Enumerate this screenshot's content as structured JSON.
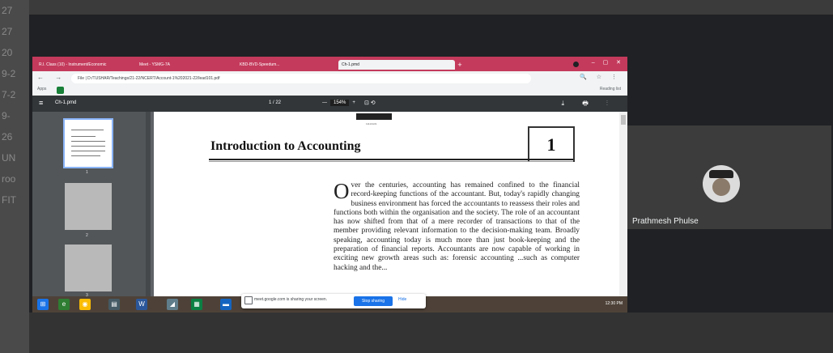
{
  "participant": {
    "name": "Prathmesh Phulse"
  },
  "browser": {
    "tabs": [
      {
        "label": "R.I. Class (10) - Instrument/Economic"
      },
      {
        "label": "Meet - YSMG-7A"
      },
      {
        "label": "KBD-BVD-Speedum..."
      },
      {
        "label": "Ch-1.pmd"
      }
    ],
    "new_tab": "+",
    "window_buttons": "– ▢ ✕",
    "nav_icons": "← → C",
    "url": "File | D:/TUSHAR/Teachings/21-22/NCERT/Account-1%202021-22/lead101.pdf",
    "address_icons": "🔍 ☆ ⋮",
    "bookmarks_apps": "Apps",
    "reading_list": "Reading list"
  },
  "pdf_toolbar": {
    "menu_icon": "≡",
    "file_name": "Ch-1.pmd",
    "page": "1 / 22",
    "zoom_minus": "—",
    "zoom": "154%",
    "zoom_plus": "+",
    "fit_icons": "⊡ ⟲",
    "actions": "⤓ 🖶 ⋮"
  },
  "thumbnails": [
    {
      "num": "1"
    },
    {
      "num": "2"
    },
    {
      "num": "3"
    }
  ],
  "document": {
    "qr_caption": "1111CH01",
    "title": "Introduction to Accounting",
    "chapter_number": "1",
    "drop_cap": "O",
    "body": "ver the centuries, accounting has remained confined to the financial record-keeping functions of the accountant. But, today's rapidly changing business environment has forced the accountants to reassess their roles and functions both within the organisation and the society. The role of an accountant has now shifted from that of a mere recorder of transactions to that of the member providing relevant information to the decision-making team. Broadly speaking, accounting today is much more than just book-keeping and the preparation of financial reports. Accountants are now capable of working in exciting new growth areas such as: forensic accounting ...such as computer hacking and the..."
  },
  "share_bar": {
    "message": "meet.google.com is sharing your screen.",
    "stop_label": "Stop sharing",
    "hide_label": "Hide"
  },
  "taskbar": {
    "icons": [
      "⊞",
      "e",
      "◉",
      "▤",
      "W",
      "◢",
      "▦",
      "▬"
    ],
    "icon_colors": [
      "#1a73e8",
      "#2e7d32",
      "#fbbc04",
      "#455a64",
      "#2b579a",
      "#607d8b",
      "#0b8043",
      "#1565c0"
    ],
    "tray": "12:30 PM"
  },
  "background_fragments": [
    "27",
    "27",
    "20",
    "9-2",
    "7-2",
    "9-",
    "26",
    "UN",
    "roo",
    "FIT",
    ""
  ]
}
